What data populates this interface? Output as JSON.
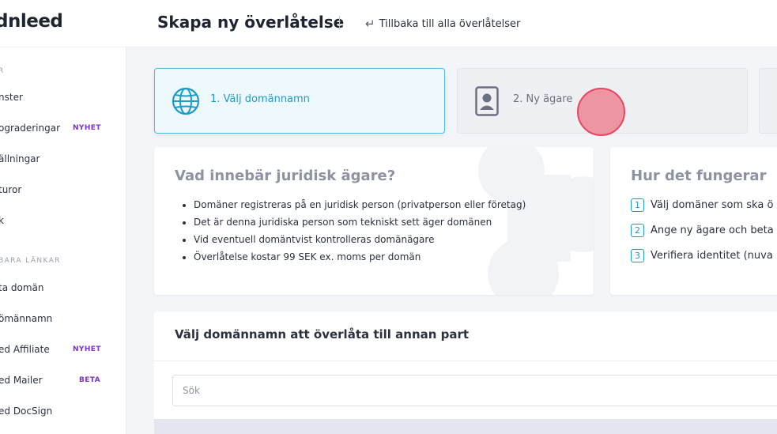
{
  "header": {
    "logo": "dnleed",
    "page_title": "Skapa ny överlåtelse",
    "back_link": "Tillbaka till alla överlåtelser"
  },
  "sidebar": {
    "section_1": "R",
    "items_1": [
      {
        "label": "nster"
      },
      {
        "label": "ograderingar",
        "badge": "NYHET"
      },
      {
        "label": "ällningar"
      },
      {
        "label": "turor"
      },
      {
        "label": "k"
      }
    ],
    "section_2": "BARA LÄNKAR",
    "items_2": [
      {
        "label": "ta domän"
      },
      {
        "label": "ömännamn"
      },
      {
        "label": "ed Affiliate",
        "badge": "NYHET"
      },
      {
        "label": "ed Mailer",
        "badge": "BETA"
      },
      {
        "label": "ed DocSign"
      }
    ]
  },
  "steps": [
    {
      "label": "1. Välj domännamn",
      "icon": "globe-icon",
      "active": true
    },
    {
      "label": "2. Ny ägare",
      "icon": "id-badge-icon",
      "active": false
    }
  ],
  "info_card": {
    "title": "Vad innebär juridisk ägare?",
    "bullets": [
      "Domäner registreras på en juridisk person (privatperson eller företag)",
      "Det är denna juridiska person som tekniskt sett äger domänen",
      "Vid eventuell domäntvist kontrolleras domänägare",
      "Överlåtelse kostar 99 SEK ex. moms per domän"
    ]
  },
  "howto_card": {
    "title": "Hur det fungerar",
    "steps": [
      {
        "num": "1",
        "text": "Välj domäner som ska ö"
      },
      {
        "num": "2",
        "text": "Ange ny ägare och beta"
      },
      {
        "num": "3",
        "text": "Verifiera identitet (nuva"
      }
    ]
  },
  "domain_panel": {
    "title": "Välj domännamn att överlåta till annan part",
    "search_placeholder": "Sök"
  },
  "colors": {
    "accent": "#1d9ccb",
    "badge": "#7d33c6",
    "cursor": "#e8465f"
  }
}
